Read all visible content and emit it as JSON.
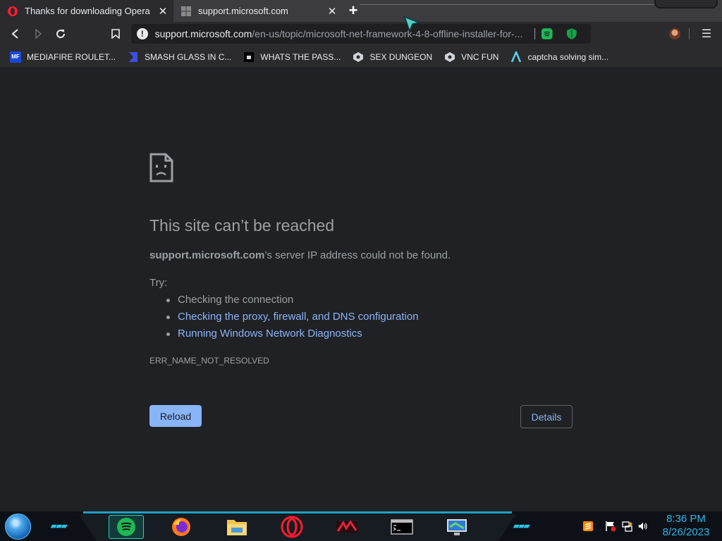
{
  "browser": {
    "tabs": [
      {
        "title": "Thanks for downloading Opera",
        "active": true,
        "favicon": "opera-icon"
      },
      {
        "title": "support.microsoft.com",
        "active": false,
        "favicon": "microsoft-icon"
      }
    ],
    "new_tab_icon": "plus-icon",
    "toolbar": {
      "back_icon": "back-arrow-icon",
      "forward_icon": "forward-arrow-icon",
      "reload_icon": "reload-icon",
      "bookmark_icon": "bookmark-icon",
      "url_host": "support.microsoft.com",
      "url_path": "/en-us/topic/microsoft-net-framework-4-8-offline-installer-for-...",
      "extensions": [
        "spotify-extension-icon",
        "shield-extension-icon"
      ],
      "menu_icon": "kebab-menu-icon"
    },
    "bookmarks": [
      {
        "label": "MEDIAFIRE ROULET...",
        "icon": "mediafire-icon",
        "icon_text": "MF"
      },
      {
        "label": "SMASH GLASS IN C...",
        "icon": "smash-icon",
        "icon_text": ""
      },
      {
        "label": "WHATS THE PASS...",
        "icon": "pass-icon",
        "icon_text": ""
      },
      {
        "label": "SEX DUNGEON",
        "icon": "dungeon-icon",
        "icon_text": ""
      },
      {
        "label": "VNC FUN",
        "icon": "vnc-icon",
        "icon_text": ""
      },
      {
        "label": "captcha solving sim...",
        "icon": "captcha-icon",
        "icon_text": ""
      }
    ]
  },
  "error_page": {
    "icon": "sad-page-icon",
    "title": "This site can’t be reached",
    "host": "support.microsoft.com",
    "description_rest": "’s server IP address could not be found.",
    "try_label": "Try:",
    "suggestions": [
      {
        "text": "Checking the connection",
        "link": false
      },
      {
        "text": "Checking the proxy, firewall, and DNS configuration",
        "link": true
      },
      {
        "text": "Running Windows Network Diagnostics",
        "link": true
      }
    ],
    "error_code": "ERR_NAME_NOT_RESOLVED",
    "reload_label": "Reload",
    "details_label": "Details"
  },
  "taskbar": {
    "start_icon": "windows-orb-icon",
    "apps": [
      "spotify-app-icon",
      "firefox-app-icon",
      "file-explorer-app-icon",
      "opera-app-icon",
      "game-app-icon",
      "cmd-app-icon",
      "remote-desktop-app-icon"
    ],
    "tray": [
      "sublime-icon",
      "action-center-flag-icon",
      "network-icon",
      "volume-icon"
    ],
    "time": "8:36 PM",
    "date": "8/26/2023"
  },
  "colors": {
    "page_bg": "#202124",
    "text_secondary": "#9aa0a6",
    "link": "#8ab4f8",
    "button_primary": "#8ab4f8",
    "clock": "#33b5e5"
  }
}
